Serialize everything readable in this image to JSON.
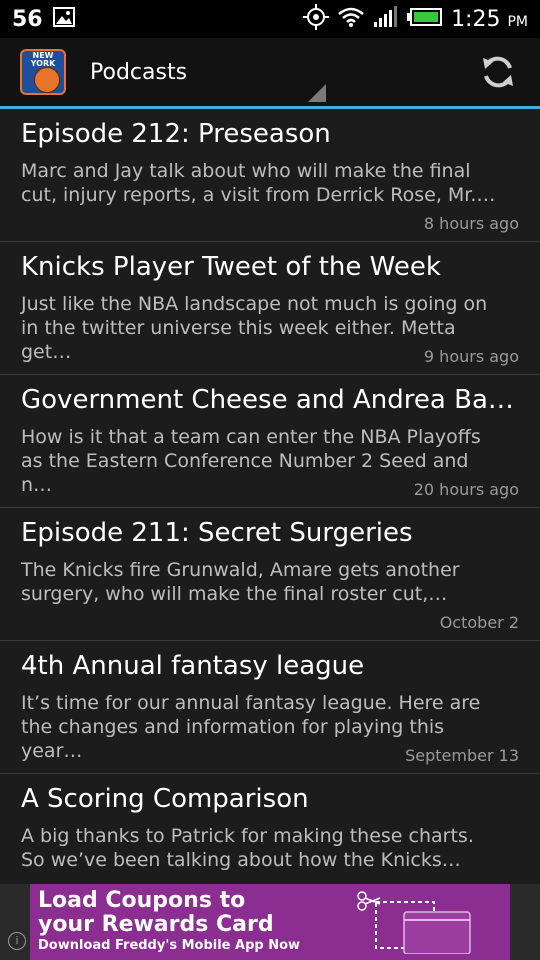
{
  "status_bar": {
    "notification_count": "56",
    "time": "1:25",
    "ampm": "PM",
    "icons": [
      "image-icon",
      "gps-icon",
      "wifi-icon",
      "signal-icon",
      "battery-icon"
    ]
  },
  "action_bar": {
    "app_logo_text": "NEW YORK",
    "title": "Podcasts",
    "refresh_icon": "refresh-icon"
  },
  "episodes": [
    {
      "title": "Episode 212: Preseason",
      "desc": "Marc and Jay talk about who will make the final cut, injury reports, a visit from Derrick Rose, Mr.…",
      "time": "8 hours ago"
    },
    {
      "title": "Knicks Player Tweet of the Week",
      "desc": "Just like the NBA landscape not much is going on in the twitter universe this week either. Metta get…",
      "time": "9 hours ago"
    },
    {
      "title": "Government Cheese and Andrea Bargna…",
      "desc": "How is it that a team can enter the NBA Playoffs as the Eastern Conference Number 2 Seed and n…",
      "time": "20 hours ago"
    },
    {
      "title": "Episode 211: Secret Surgeries",
      "desc": "The Knicks fire Grunwald, Amare gets another surgery, who will make the final roster cut,…",
      "time": "October 2"
    },
    {
      "title": "4th Annual fantasy league",
      "desc": "It’s time for our annual fantasy league.  Here are the changes and information for playing this year…",
      "time": "September 13"
    },
    {
      "title": "A Scoring Comparison",
      "desc": "A big thanks to Patrick for making these charts. So we’ve been talking about how the Knicks…",
      "time": ""
    }
  ],
  "ad": {
    "line1": "Load Coupons to",
    "line2": "your Rewards Card",
    "line3": "Download Freddy's Mobile App Now",
    "info_icon": "info-icon"
  },
  "colors": {
    "accent": "#33b5e5",
    "ad_bg": "#8c2e91",
    "background": "#1c1c1c"
  }
}
